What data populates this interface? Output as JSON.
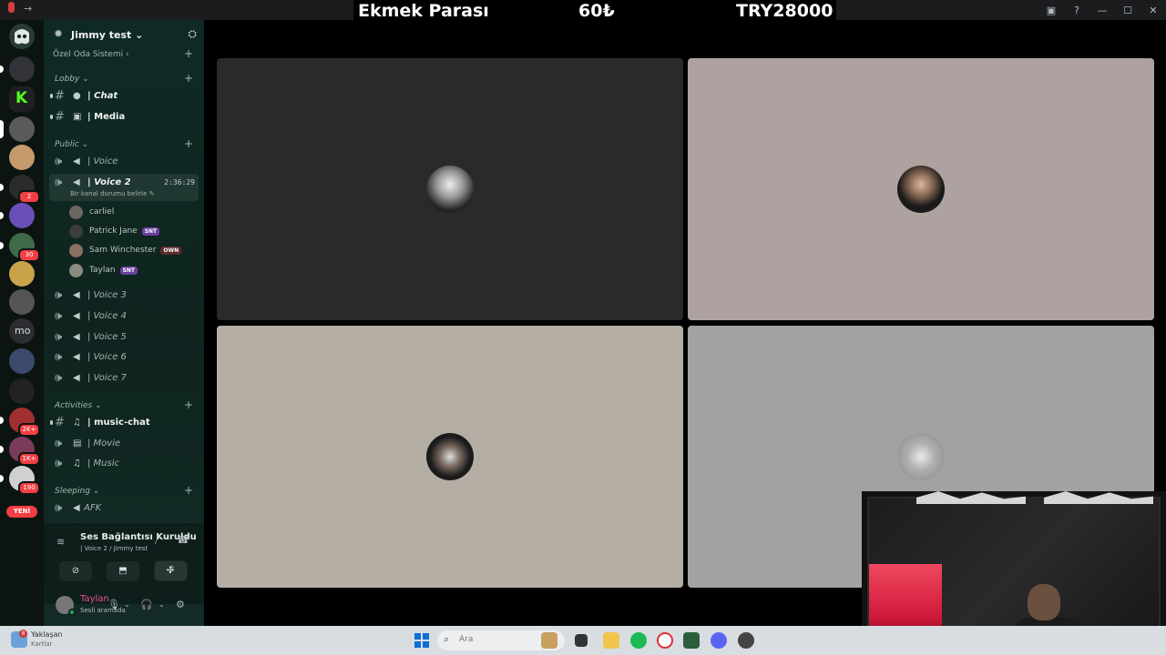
{
  "window": {
    "banner": {
      "item": "Ekmek Parası",
      "price": "60₺",
      "balance": "TRY28000"
    }
  },
  "server": {
    "name": "Jimmy test ⌄",
    "rail_badges": {
      "b1": "2",
      "b2": "30",
      "b3": "2K+",
      "b4": "1K+",
      "b5": "190"
    },
    "rail_label_mo": "mo",
    "new_label": "YENİ"
  },
  "sidebar": {
    "category_ozel": "Özel Oda Sistemi ›",
    "category_lobby": "Lobby ⌄",
    "category_public": "Public ⌄",
    "category_activities": "Activities ⌄",
    "category_sleeping": "Sleeping ⌄",
    "channels": {
      "chat": "| Chat",
      "media": "| Media",
      "voice": "| Voice",
      "voice2": "| Voice 2",
      "voice2_timer": "2:36:29",
      "voice2_status": "Bir kanal durumu belirle ✎",
      "voice3": "| Voice 3",
      "voice4": "| Voice 4",
      "voice5": "| Voice 5",
      "voice6": "| Voice 6",
      "voice7": "| Voice 7",
      "music_chat": "| music-chat",
      "movie": "| Movie",
      "music": "| Music",
      "afk": "AFK"
    },
    "voice_users": [
      {
        "name": "carliel",
        "tag": ""
      },
      {
        "name": "Patrick Jane",
        "tag": "SNT"
      },
      {
        "name": "Sam Winchester",
        "tag": "OWN"
      },
      {
        "name": "Taylan",
        "tag": "SNT"
      }
    ]
  },
  "voice_panel": {
    "status": "Ses Bağlantısı Kuruldu",
    "location": "| Voice 2 / Jimmy test"
  },
  "user_panel": {
    "name": "Taylan",
    "status": "Sesli aramada"
  },
  "taskbar": {
    "weather_title": "Yaklaşan",
    "weather_sub": "Kartlar",
    "weather_badge": "8",
    "search_placeholder": "Ara"
  },
  "colors": {
    "accent_pink": "#e8508f",
    "online": "#23a55a",
    "badge_red": "#f23f43",
    "sidebar_bg": "#0f2a25"
  }
}
